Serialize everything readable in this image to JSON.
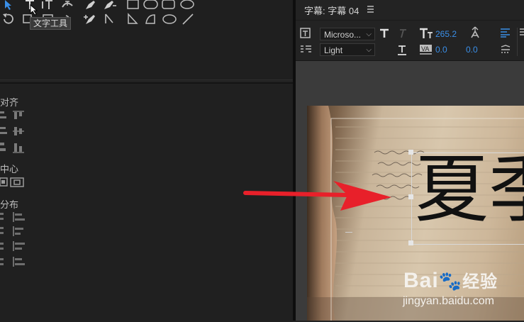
{
  "tooltip": {
    "text_tool": "文字工具"
  },
  "tools": {
    "row1": [
      "selection-arrow-icon",
      "text-tool-icon",
      "vertical-text-tool-icon",
      "path-text-icon",
      "pen-icon",
      "add-anchor-pen-icon",
      "rectangle-icon",
      "rounded-rect-icon",
      "clipped-rect-icon",
      "ellipse-icon"
    ],
    "row2": [
      "rotate-icon",
      "area-text-icon",
      "vertical-area-text-icon",
      "convert-anchor-icon",
      "add-anchor-icon",
      "convert-point-icon",
      "wedge-icon",
      "arc-icon",
      "ellipse-icon",
      "line-icon"
    ]
  },
  "align_panel": {
    "section_align": "对齐",
    "section_center": "中心",
    "section_distribute": "分布"
  },
  "title_panel": {
    "title": "字幕: 字幕 04",
    "menu_icon": "hamburger-menu-icon",
    "font_family": "Microso...",
    "font_style": "Light",
    "font_size": "265.2",
    "kerning": "0.0",
    "leading": "0.0"
  },
  "canvas": {
    "title_text": "夏季",
    "watermark_brand": "Bai",
    "watermark_cn": "经验",
    "watermark_url": "jingyan.baidu.com"
  },
  "colors": {
    "accent_blue": "#3a8fe8",
    "arrow_red": "#e8202a"
  }
}
